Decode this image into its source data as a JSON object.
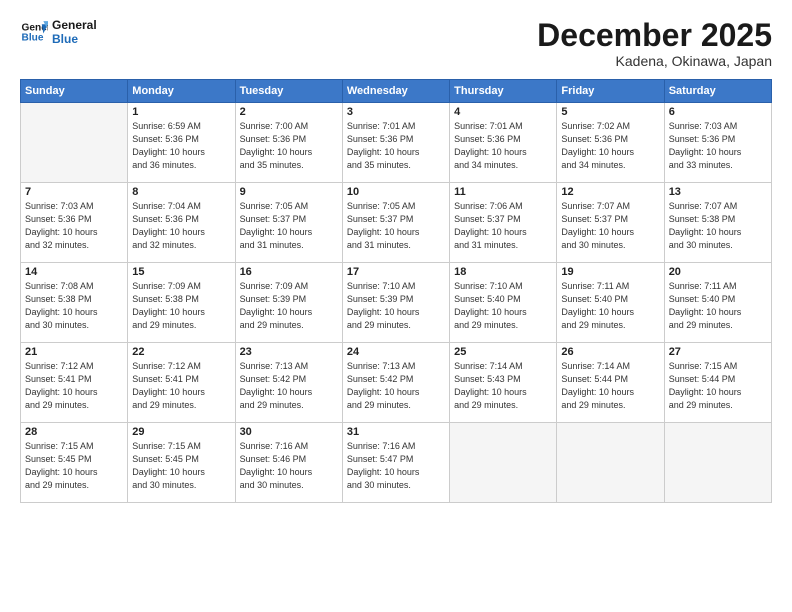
{
  "header": {
    "logo_line1": "General",
    "logo_line2": "Blue",
    "month_title": "December 2025",
    "location": "Kadena, Okinawa, Japan"
  },
  "days_of_week": [
    "Sunday",
    "Monday",
    "Tuesday",
    "Wednesday",
    "Thursday",
    "Friday",
    "Saturday"
  ],
  "weeks": [
    [
      {
        "day": "",
        "info": ""
      },
      {
        "day": "1",
        "info": "Sunrise: 6:59 AM\nSunset: 5:36 PM\nDaylight: 10 hours\nand 36 minutes."
      },
      {
        "day": "2",
        "info": "Sunrise: 7:00 AM\nSunset: 5:36 PM\nDaylight: 10 hours\nand 35 minutes."
      },
      {
        "day": "3",
        "info": "Sunrise: 7:01 AM\nSunset: 5:36 PM\nDaylight: 10 hours\nand 35 minutes."
      },
      {
        "day": "4",
        "info": "Sunrise: 7:01 AM\nSunset: 5:36 PM\nDaylight: 10 hours\nand 34 minutes."
      },
      {
        "day": "5",
        "info": "Sunrise: 7:02 AM\nSunset: 5:36 PM\nDaylight: 10 hours\nand 34 minutes."
      },
      {
        "day": "6",
        "info": "Sunrise: 7:03 AM\nSunset: 5:36 PM\nDaylight: 10 hours\nand 33 minutes."
      }
    ],
    [
      {
        "day": "7",
        "info": "Sunrise: 7:03 AM\nSunset: 5:36 PM\nDaylight: 10 hours\nand 32 minutes."
      },
      {
        "day": "8",
        "info": "Sunrise: 7:04 AM\nSunset: 5:36 PM\nDaylight: 10 hours\nand 32 minutes."
      },
      {
        "day": "9",
        "info": "Sunrise: 7:05 AM\nSunset: 5:37 PM\nDaylight: 10 hours\nand 31 minutes."
      },
      {
        "day": "10",
        "info": "Sunrise: 7:05 AM\nSunset: 5:37 PM\nDaylight: 10 hours\nand 31 minutes."
      },
      {
        "day": "11",
        "info": "Sunrise: 7:06 AM\nSunset: 5:37 PM\nDaylight: 10 hours\nand 31 minutes."
      },
      {
        "day": "12",
        "info": "Sunrise: 7:07 AM\nSunset: 5:37 PM\nDaylight: 10 hours\nand 30 minutes."
      },
      {
        "day": "13",
        "info": "Sunrise: 7:07 AM\nSunset: 5:38 PM\nDaylight: 10 hours\nand 30 minutes."
      }
    ],
    [
      {
        "day": "14",
        "info": "Sunrise: 7:08 AM\nSunset: 5:38 PM\nDaylight: 10 hours\nand 30 minutes."
      },
      {
        "day": "15",
        "info": "Sunrise: 7:09 AM\nSunset: 5:38 PM\nDaylight: 10 hours\nand 29 minutes."
      },
      {
        "day": "16",
        "info": "Sunrise: 7:09 AM\nSunset: 5:39 PM\nDaylight: 10 hours\nand 29 minutes."
      },
      {
        "day": "17",
        "info": "Sunrise: 7:10 AM\nSunset: 5:39 PM\nDaylight: 10 hours\nand 29 minutes."
      },
      {
        "day": "18",
        "info": "Sunrise: 7:10 AM\nSunset: 5:40 PM\nDaylight: 10 hours\nand 29 minutes."
      },
      {
        "day": "19",
        "info": "Sunrise: 7:11 AM\nSunset: 5:40 PM\nDaylight: 10 hours\nand 29 minutes."
      },
      {
        "day": "20",
        "info": "Sunrise: 7:11 AM\nSunset: 5:40 PM\nDaylight: 10 hours\nand 29 minutes."
      }
    ],
    [
      {
        "day": "21",
        "info": "Sunrise: 7:12 AM\nSunset: 5:41 PM\nDaylight: 10 hours\nand 29 minutes."
      },
      {
        "day": "22",
        "info": "Sunrise: 7:12 AM\nSunset: 5:41 PM\nDaylight: 10 hours\nand 29 minutes."
      },
      {
        "day": "23",
        "info": "Sunrise: 7:13 AM\nSunset: 5:42 PM\nDaylight: 10 hours\nand 29 minutes."
      },
      {
        "day": "24",
        "info": "Sunrise: 7:13 AM\nSunset: 5:42 PM\nDaylight: 10 hours\nand 29 minutes."
      },
      {
        "day": "25",
        "info": "Sunrise: 7:14 AM\nSunset: 5:43 PM\nDaylight: 10 hours\nand 29 minutes."
      },
      {
        "day": "26",
        "info": "Sunrise: 7:14 AM\nSunset: 5:44 PM\nDaylight: 10 hours\nand 29 minutes."
      },
      {
        "day": "27",
        "info": "Sunrise: 7:15 AM\nSunset: 5:44 PM\nDaylight: 10 hours\nand 29 minutes."
      }
    ],
    [
      {
        "day": "28",
        "info": "Sunrise: 7:15 AM\nSunset: 5:45 PM\nDaylight: 10 hours\nand 29 minutes."
      },
      {
        "day": "29",
        "info": "Sunrise: 7:15 AM\nSunset: 5:45 PM\nDaylight: 10 hours\nand 30 minutes."
      },
      {
        "day": "30",
        "info": "Sunrise: 7:16 AM\nSunset: 5:46 PM\nDaylight: 10 hours\nand 30 minutes."
      },
      {
        "day": "31",
        "info": "Sunrise: 7:16 AM\nSunset: 5:47 PM\nDaylight: 10 hours\nand 30 minutes."
      },
      {
        "day": "",
        "info": ""
      },
      {
        "day": "",
        "info": ""
      },
      {
        "day": "",
        "info": ""
      }
    ]
  ]
}
